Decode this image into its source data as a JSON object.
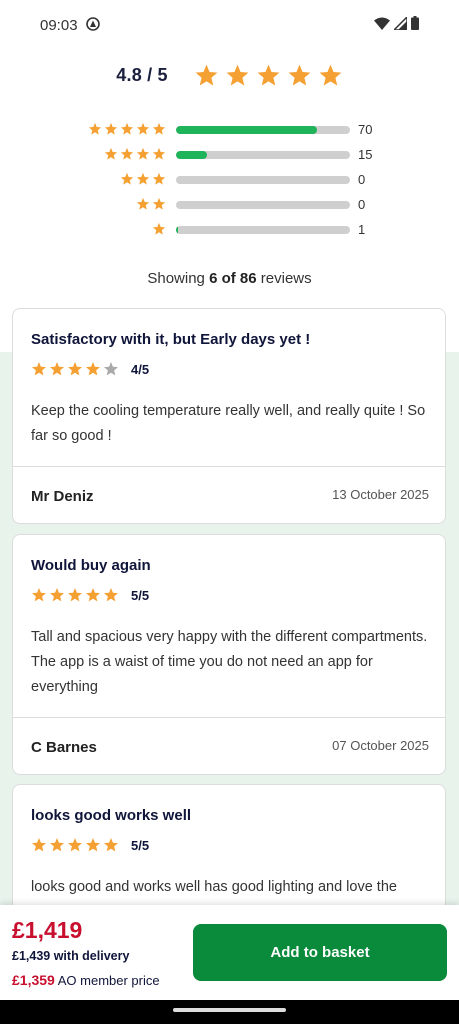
{
  "status": {
    "time": "09:03"
  },
  "rating": {
    "score_label": "4.8 / 5",
    "stars": 5,
    "breakdown": [
      {
        "stars": 5,
        "count": "70",
        "fraction": 0.81
      },
      {
        "stars": 4,
        "count": "15",
        "fraction": 0.18
      },
      {
        "stars": 3,
        "count": "0",
        "fraction": 0
      },
      {
        "stars": 2,
        "count": "0",
        "fraction": 0
      },
      {
        "stars": 1,
        "count": "1",
        "fraction": 0.012
      }
    ]
  },
  "showing": {
    "prefix": "Showing",
    "shown": "6 of 86",
    "suffix": "reviews"
  },
  "reviews": [
    {
      "title": "Satisfactory with it, but Early days yet !",
      "rating": 4,
      "rating_label": "4/5",
      "body": "Keep the cooling temperature really well, and really quite ! So far so good !",
      "author": "Mr Deniz",
      "date": "13 October 2025"
    },
    {
      "title": "Would buy again",
      "rating": 5,
      "rating_label": "5/5",
      "body": "Tall and spacious very happy with the different compartments. The app is a waist of time you do not need an app for everything",
      "author": "C Barnes",
      "date": "07 October 2025"
    },
    {
      "title": "looks good works well",
      "rating": 5,
      "rating_label": "5/5",
      "body": "looks good and works well has good lighting and love the",
      "author": "",
      "date": ""
    }
  ],
  "purchase": {
    "price": "£1,419",
    "delivery": "£1,439 with delivery",
    "member_price": "£1,359",
    "member_label": "AO member price",
    "button": "Add to basket"
  },
  "colors": {
    "star": "#f5a032",
    "star_empty": "#a9a9a9",
    "bar_fill": "#1fb35a",
    "price_red": "#c8102e",
    "button_green": "#0a8a3b"
  }
}
